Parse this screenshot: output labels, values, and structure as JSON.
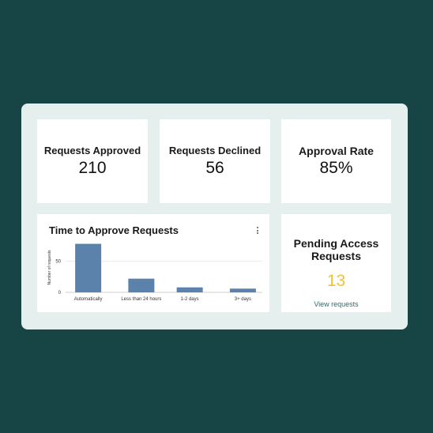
{
  "stats": {
    "approved": {
      "label": "Requests Approved",
      "value": "210"
    },
    "declined": {
      "label": "Requests Declined",
      "value": "56"
    },
    "rate": {
      "label": "Approval Rate",
      "value": "85%"
    }
  },
  "pending": {
    "title": "Pending Access Requests",
    "value": "13",
    "link": "View requests"
  },
  "colors": {
    "background": "#174445",
    "panel": "#e4efee",
    "bar": "#5b82ab",
    "pending_value": "#f0c23b",
    "link": "#2a6e6a"
  },
  "chart": {
    "title": "Time to Approve Requests",
    "menu_icon": "kebab-menu-icon"
  },
  "chart_data": {
    "type": "bar",
    "title": "Time to Approve Requests",
    "ylabel": "Number of requests",
    "xlabel": "",
    "categories": [
      "Automatically",
      "Less than 24 hours",
      "1-2 days",
      "3+ days"
    ],
    "values": [
      78,
      22,
      8,
      6
    ],
    "yticks": [
      0,
      50
    ],
    "ylim": [
      0,
      80
    ],
    "grid": true
  }
}
